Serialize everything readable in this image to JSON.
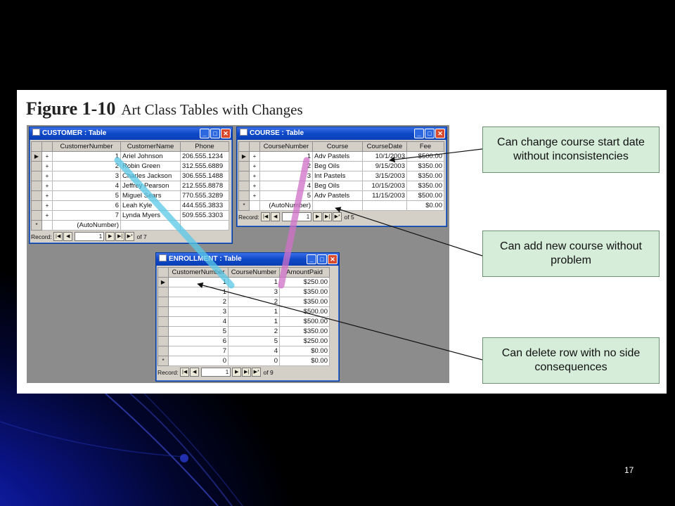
{
  "figure": {
    "number": "Figure 1-10",
    "caption": "Art Class Tables with Changes"
  },
  "customer_table": {
    "title": "CUSTOMER : Table",
    "columns": [
      "CustomerNumber",
      "CustomerName",
      "Phone"
    ],
    "rows": [
      [
        "1",
        "Ariel Johnson",
        "206.555.1234"
      ],
      [
        "2",
        "Robin Green",
        "312.555.6889"
      ],
      [
        "3",
        "Charles Jackson",
        "306.555.1488"
      ],
      [
        "4",
        "Jeffrey Pearson",
        "212.555.8878"
      ],
      [
        "5",
        "Miguel Sears",
        "770.555.3289"
      ],
      [
        "6",
        "Leah Kyle",
        "444.555.3833"
      ],
      [
        "7",
        "Lynda Myers",
        "509.555.3303"
      ]
    ],
    "new_row_label": "(AutoNumber)",
    "nav": {
      "record_label": "Record:",
      "current": "1",
      "of_text": "of 7"
    }
  },
  "course_table": {
    "title": "COURSE : Table",
    "columns": [
      "CourseNumber",
      "Course",
      "CourseDate",
      "Fee"
    ],
    "rows": [
      [
        "1",
        "Adv Pastels",
        "10/1/2003",
        "$500.00"
      ],
      [
        "2",
        "Beg Oils",
        "9/15/2003",
        "$350.00"
      ],
      [
        "3",
        "Int Pastels",
        "3/15/2003",
        "$350.00"
      ],
      [
        "4",
        "Beg Oils",
        "10/15/2003",
        "$350.00"
      ],
      [
        "5",
        "Adv Pastels",
        "11/15/2003",
        "$500.00"
      ]
    ],
    "new_row_label": "(AutoNumber)",
    "new_row_fee": "$0.00",
    "nav": {
      "record_label": "Record:",
      "current": "1",
      "of_text": "of 5"
    }
  },
  "enrollment_table": {
    "title": "ENROLLMENT : Table",
    "columns": [
      "CustomerNumber",
      "CourseNumber",
      "AmountPaid"
    ],
    "rows": [
      [
        "1",
        "1",
        "$250.00"
      ],
      [
        "1",
        "3",
        "$350.00"
      ],
      [
        "2",
        "2",
        "$350.00"
      ],
      [
        "3",
        "1",
        "$500.00"
      ],
      [
        "4",
        "1",
        "$500.00"
      ],
      [
        "5",
        "2",
        "$350.00"
      ],
      [
        "6",
        "5",
        "$250.00"
      ],
      [
        "7",
        "4",
        "$0.00"
      ],
      [
        "0",
        "0",
        "$0.00"
      ]
    ],
    "nav": {
      "record_label": "Record:",
      "current": "1",
      "of_text": "of 9"
    }
  },
  "callouts": [
    "Can change course start date without inconsistencies",
    "Can add new course without problem",
    "Can delete row with no side consequences"
  ],
  "page_number": "17",
  "colors": {
    "callout_fill": "#d6edd9",
    "customer_link": "#58c8e8",
    "course_link": "#d070c8",
    "titlebar": "#0f49c8"
  }
}
